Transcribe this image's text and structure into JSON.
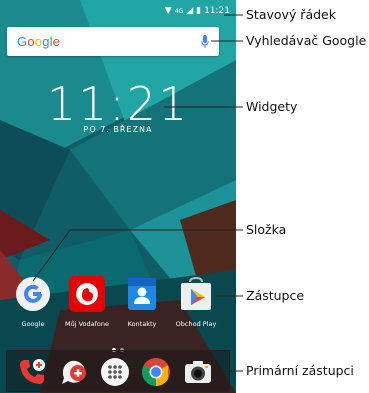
{
  "status_bar": {
    "signal_label": "4G",
    "time": "11:21"
  },
  "search": {
    "logo_text": "Google"
  },
  "clock_widget": {
    "time": "11:21",
    "date": "PO 7. BŘEZNA"
  },
  "apps": [
    {
      "label": "Google",
      "icon": "google-g-icon"
    },
    {
      "label": "Můj Vodafone",
      "icon": "vodafone-icon"
    },
    {
      "label": "Kontakty",
      "icon": "contacts-icon"
    },
    {
      "label": "Obchod Play",
      "icon": "play-store-icon"
    }
  ],
  "dock": [
    {
      "icon": "phone-icon"
    },
    {
      "icon": "messages-icon"
    },
    {
      "icon": "app-drawer-icon"
    },
    {
      "icon": "chrome-icon"
    },
    {
      "icon": "camera-icon"
    }
  ],
  "callouts": {
    "status_bar": "Stavový řádek",
    "search": "Vyhledávač Google",
    "widgets": "Widgety",
    "folder": "Složka",
    "shortcut": "Zástupce",
    "primary_shortcuts": "Primární zástupci"
  },
  "colors": {
    "wallpaper": "#11606b",
    "vodafone_red": "#e60000",
    "google_blue": "#4285f4"
  }
}
